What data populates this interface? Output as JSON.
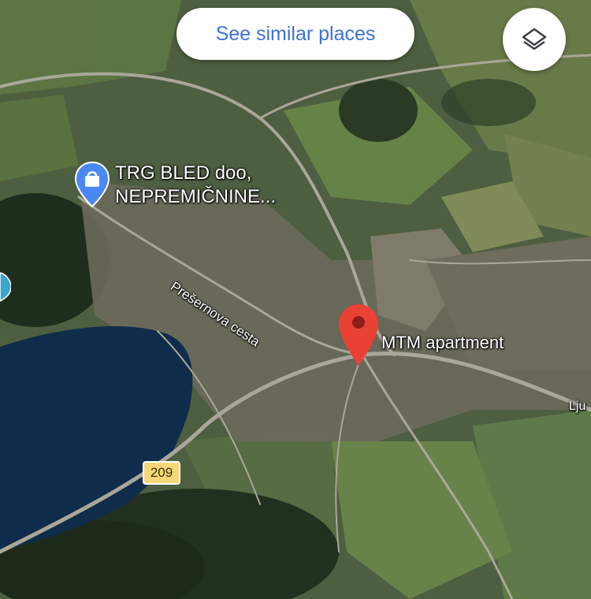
{
  "top_bar": {
    "see_similar_label": "See similar places",
    "layers_icon": "layers-icon"
  },
  "places": {
    "shop_poi": {
      "line1": "TRG BLED doo,",
      "line2": "NEPREMIČNINE...",
      "icon": "shopping-bag-icon",
      "pin_color": "#4a89f3"
    },
    "selected_place": {
      "name": "MTM apartment",
      "icon": "red-pin-icon",
      "pin_color": "#e94235"
    }
  },
  "streets": {
    "presernova": "Prešernova cesta",
    "edge_label": "Lju"
  },
  "route_badge": "209",
  "colors": {
    "chip_text": "#3b72d9",
    "route_badge": "#f5d77a",
    "lake": "#0f2c4a"
  }
}
